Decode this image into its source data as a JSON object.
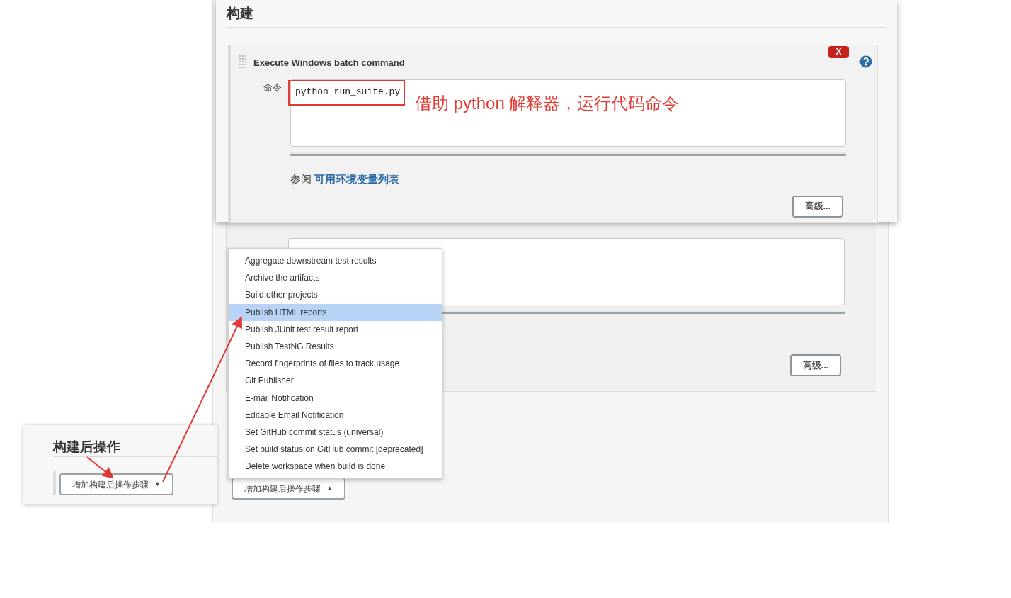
{
  "background_page": {
    "advanced_button": "高级...",
    "add_step_button": {
      "label": "增加构建后操作步骤",
      "caret": "▲"
    }
  },
  "build_overlay": {
    "heading": "构建",
    "step": {
      "title": "Execute Windows batch command",
      "delete_button": "X",
      "command_label": "命令",
      "command": "python run_suite.py",
      "annotation": "借助 python 解释器，运行代码命令",
      "see_also": "参阅",
      "env_link": "可用环境变量列表",
      "advanced_button": "高级..."
    }
  },
  "dropdown_menu": [
    {
      "label": "Aggregate downstream test results",
      "selected": false
    },
    {
      "label": "Archive the artifacts",
      "selected": false
    },
    {
      "label": "Build other projects",
      "selected": false
    },
    {
      "label": "Publish HTML reports",
      "selected": true
    },
    {
      "label": "Publish JUnit test result report",
      "selected": false
    },
    {
      "label": "Publish TestNG Results",
      "selected": false
    },
    {
      "label": "Record fingerprints of files to track usage",
      "selected": false
    },
    {
      "label": "Git Publisher",
      "selected": false
    },
    {
      "label": "E-mail Notification",
      "selected": false
    },
    {
      "label": "Editable Email Notification",
      "selected": false
    },
    {
      "label": "Set GitHub commit status (universal)",
      "selected": false
    },
    {
      "label": "Set build status on GitHub commit [deprecated]",
      "selected": false
    },
    {
      "label": "Delete workspace when build is done",
      "selected": false
    }
  ],
  "post_build_overlay": {
    "heading": "构建后操作",
    "add_step_button": {
      "label": "增加构建后操作步骤",
      "caret": "▼"
    }
  }
}
